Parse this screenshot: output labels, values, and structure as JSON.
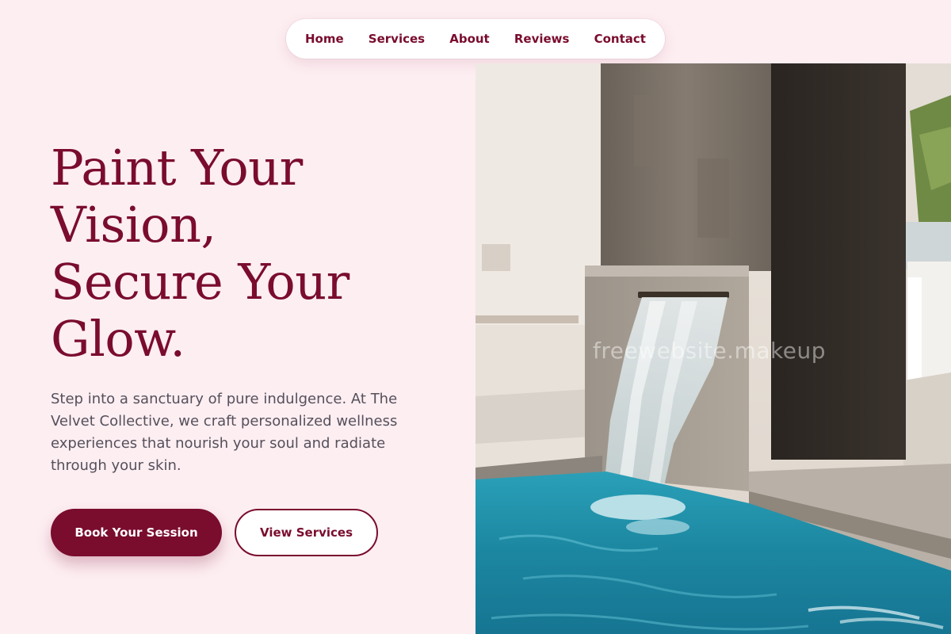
{
  "nav": {
    "items": [
      {
        "label": "Home"
      },
      {
        "label": "Services"
      },
      {
        "label": "About"
      },
      {
        "label": "Reviews"
      },
      {
        "label": "Contact"
      }
    ]
  },
  "hero": {
    "headline_lines": [
      "Paint Your",
      "Vision,",
      "Secure Your",
      "Glow."
    ],
    "subtext": "Step into a sanctuary of pure indulgence. At The Velvet Collective, we craft personalized wellness experiences that nourish your soul and radiate through your skin.",
    "primary_cta": "Book Your Session",
    "secondary_cta": "View Services"
  },
  "watermark": "freewebsite.makeup",
  "colors": {
    "background": "#fdeef2",
    "accent": "#7a0c2e",
    "body_text": "#55505a",
    "pool_water": "#1f8fa8"
  }
}
